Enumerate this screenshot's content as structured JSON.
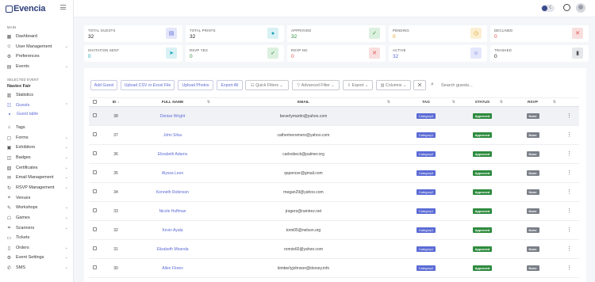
{
  "brand": {
    "name": "Evencia"
  },
  "sidebar": {
    "main_label": "Main",
    "selected_event_label": "Selected Event",
    "event_name": "Nastex Fair",
    "items": [
      {
        "label": "Dashboard",
        "icon": "dashboard-icon"
      },
      {
        "label": "User Management",
        "icon": "user-icon"
      },
      {
        "label": "Preferences",
        "icon": "preferences-icon"
      },
      {
        "label": "Events",
        "icon": "calendar-icon"
      },
      {
        "label": "Statistics",
        "icon": "statistics-icon"
      },
      {
        "label": "Guests",
        "icon": "guests-icon"
      },
      {
        "label": "Tags",
        "icon": "tag-icon"
      },
      {
        "label": "Forms",
        "icon": "form-icon"
      },
      {
        "label": "Exhibitors",
        "icon": "exhibitor-icon"
      },
      {
        "label": "Badges",
        "icon": "badge-icon"
      },
      {
        "label": "Certificates",
        "icon": "certificate-icon"
      },
      {
        "label": "Email Management",
        "icon": "email-icon"
      },
      {
        "label": "RSVP Management",
        "icon": "rsvp-icon"
      },
      {
        "label": "Venues",
        "icon": "venue-icon"
      },
      {
        "label": "Workshops",
        "icon": "workshop-icon"
      },
      {
        "label": "Games",
        "icon": "games-icon"
      },
      {
        "label": "Scanners",
        "icon": "scanner-icon"
      },
      {
        "label": "Tickets",
        "icon": "ticket-icon"
      },
      {
        "label": "Orders",
        "icon": "orders-icon"
      },
      {
        "label": "Event Settings",
        "icon": "settings-icon"
      },
      {
        "label": "SMS",
        "icon": "sms-icon"
      }
    ],
    "sub_item": "Guest table"
  },
  "stats": [
    {
      "label": "Total Guests",
      "value": "32",
      "icon": "id-card-icon",
      "color": "#5b6bd5",
      "bg": "#e4e7fb",
      "value_color": "#222"
    },
    {
      "label": "Total Prints",
      "value": "32",
      "icon": "print-icon",
      "color": "#17a2b8",
      "bg": "#d9f1f5",
      "value_color": "#222"
    },
    {
      "label": "Approved",
      "value": "32",
      "icon": "check-icon",
      "color": "#2e8b3e",
      "bg": "#dcf0df",
      "value_color": "#2e8b3e"
    },
    {
      "label": "Pending",
      "value": "0",
      "icon": "clock-icon",
      "color": "#e0a020",
      "bg": "#fbefd2",
      "value_color": "#e0a020"
    },
    {
      "label": "Declined",
      "value": "0",
      "icon": "close-icon",
      "color": "#d9534f",
      "bg": "#f9dede",
      "value_color": "#d9534f"
    },
    {
      "label": "Invitation Sent",
      "value": "0",
      "icon": "send-icon",
      "color": "#17a2b8",
      "bg": "#d9f1f5",
      "value_color": "#17a2b8"
    },
    {
      "label": "RSVP Yes",
      "value": "0",
      "icon": "check-icon",
      "color": "#2e8b3e",
      "bg": "#dcf0df",
      "value_color": "#2e8b3e"
    },
    {
      "label": "RSVP No",
      "value": "0",
      "icon": "close-icon",
      "color": "#d9534f",
      "bg": "#f9dede",
      "value_color": "#d9534f"
    },
    {
      "label": "Active",
      "value": "32",
      "icon": "user-icon",
      "color": "#5b6bd5",
      "bg": "#e4e7fb",
      "value_color": "#5b6bd5"
    },
    {
      "label": "Trashed",
      "value": "0",
      "icon": "trash-icon",
      "color": "#555",
      "bg": "#e6e7ea",
      "value_color": "#222"
    }
  ],
  "toolbar": {
    "add_guest": "Add Guest",
    "upload": "Upload CSV or Excel File",
    "upload_photos": "Upload Photos",
    "export_all": "Export All",
    "quick_filters": "Quick Filters",
    "advanced_filter": "Advanced Filter",
    "export": "Export",
    "columns": "Columns",
    "search_placeholder": "Search guests..."
  },
  "table": {
    "headers": [
      "ID",
      "Full Name",
      "Email",
      "Tag",
      "Status",
      "RSVP"
    ],
    "rows": [
      {
        "id": "38",
        "name": "Denise Wright",
        "email": "beverlymartin@yahoo.com",
        "tag": "Category3",
        "status": "Approved",
        "rsvp": "None"
      },
      {
        "id": "37",
        "name": "John Silva",
        "email": "catherineromero@yahoo.com",
        "tag": "Category1",
        "status": "Approved",
        "rsvp": "None"
      },
      {
        "id": "36",
        "name": "Elizabeth Adams",
        "email": "carlosbeck@palmer.org",
        "tag": "Category2",
        "status": "Approved",
        "rsvp": "None"
      },
      {
        "id": "35",
        "name": "Alyssa Leon",
        "email": "qspencer@gmail.com",
        "tag": "Category3",
        "status": "Approved",
        "rsvp": "None"
      },
      {
        "id": "34",
        "name": "Kenneth Robinson",
        "email": "megan29@yahoo.com",
        "tag": "Category2",
        "status": "Approved",
        "rsvp": "None"
      },
      {
        "id": "33",
        "name": "Nicole Huffman",
        "email": "jrogers@ramirez.net",
        "tag": "Category1",
        "status": "Approved",
        "rsvp": "None"
      },
      {
        "id": "32",
        "name": "Kevin Ayala",
        "email": "tomi05@nelson.org",
        "tag": "Category1",
        "status": "Approved",
        "rsvp": "None"
      },
      {
        "id": "31",
        "name": "Elizabeth Miranda",
        "email": "ronnie60@yahoo.com",
        "tag": "Category1",
        "status": "Approved",
        "rsvp": "None"
      },
      {
        "id": "30",
        "name": "Allen Flores",
        "email": "kimberlyjohnson@dorsey.info",
        "tag": "Category2",
        "status": "Approved",
        "rsvp": "None"
      }
    ]
  }
}
